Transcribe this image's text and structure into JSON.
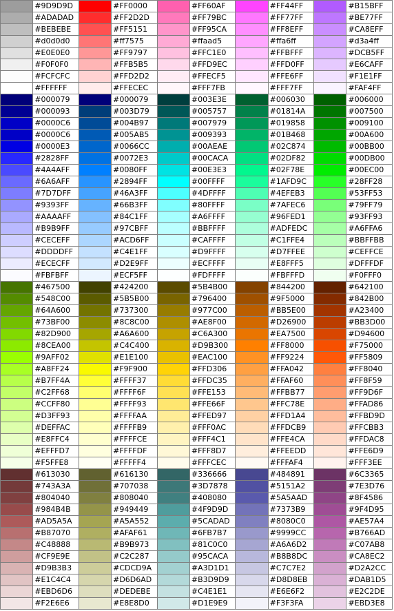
{
  "palette_rows": [
    [
      "#9D9D9D",
      "#FF0000",
      "#FF60AF",
      "#FF44FF",
      "#B15BFF"
    ],
    [
      "#ADADAD",
      "#FF2D2D",
      "#FF79BC",
      "#FF77FF",
      "#BE77FF"
    ],
    [
      "#BEBEBE",
      "#FF5151",
      "#FF95CA",
      "#FF8EFF",
      "#CA8EFF"
    ],
    [
      "#d0d0d0",
      "#ff7575",
      "#ffaad5",
      "#ffa6ff",
      "#d3a4ff"
    ],
    [
      "#E0E0E0",
      "#FF9797",
      "#FFC1E0",
      "#FFBFFF",
      "#DCB5FF"
    ],
    [
      "#F0F0F0",
      "#FFB5B5",
      "#FFD9EC",
      "#FFD0FF",
      "#E6CAFF"
    ],
    [
      "#FCFCFC",
      "#FFD2D2",
      "#FFECF5",
      "#FFE6FF",
      "#F1E1FF"
    ],
    [
      "#FFFFFF",
      "#FFECEC",
      "#FFF7FB",
      "#FFF7FF",
      "#FAF4FF"
    ],
    [
      "#000079",
      "#000079",
      "#003E3E",
      "#006030",
      "#006000"
    ],
    [
      "#000093",
      "#003D79",
      "#005757",
      "#01814A",
      "#007500"
    ],
    [
      "#0000C6",
      "#004B97",
      "#007979",
      "#019858",
      "#009100"
    ],
    [
      "#0000C6",
      "#005AB5",
      "#009393",
      "#01B468",
      "#00A600"
    ],
    [
      "#0000E3",
      "#0066CC",
      "#00AEAE",
      "#02C874",
      "#00BB00"
    ],
    [
      "#2828FF",
      "#0072E3",
      "#00CACA",
      "#02DF82",
      "#00DB00"
    ],
    [
      "#4A4AFF",
      "#0080FF",
      "#00E3E3",
      "#02F78E",
      "#00EC00"
    ],
    [
      "#6A6AFF",
      "#2894FF",
      "#00FFFF",
      "#1AFD9C",
      "#28FF28"
    ],
    [
      "#7D7DFF",
      "#46A3FF",
      "#4DFFFF",
      "#4EFEB3",
      "#53FF53"
    ],
    [
      "#9393FF",
      "#66B3FF",
      "#80FFFF",
      "#7AFEC6",
      "#79FF79"
    ],
    [
      "#AAAAFF",
      "#84C1FF",
      "#A6FFFF",
      "#96FED1",
      "#93FF93"
    ],
    [
      "#B9B9FF",
      "#97CBFF",
      "#BBFFFF",
      "#ADFEDC",
      "#A6FFA6"
    ],
    [
      "#CECEFF",
      "#ACD6FF",
      "#CAFFFF",
      "#C1FFE4",
      "#BBFFBB"
    ],
    [
      "#DDDDFF",
      "#C4E1FF",
      "#D9FFFF",
      "#D7FFEE",
      "#CEFFCE"
    ],
    [
      "#ECECFF",
      "#D2E9FF",
      "#ECFFFF",
      "#E8FFF5",
      "#DFFFDF"
    ],
    [
      "#FBFBFF",
      "#ECF5FF",
      "#FDFFFF",
      "#FBFFFD",
      "#F0FFF0"
    ],
    [
      "#467500",
      "#424200",
      "#5B4B00",
      "#844200",
      "#642100"
    ],
    [
      "#548C00",
      "#5B5B00",
      "#796400",
      "#9F5000",
      "#842B00"
    ],
    [
      "#64A600",
      "#737300",
      "#977C00",
      "#BB5E00",
      "#A23400"
    ],
    [
      "#73BF00",
      "#8C8C00",
      "#AE8F00",
      "#D26900",
      "#BB3D00"
    ],
    [
      "#82D900",
      "#A6A600",
      "#C6A300",
      "#EA7500",
      "#D94600"
    ],
    [
      "#8CEA00",
      "#C4C400",
      "#D9B300",
      "#FF8000",
      "#F75000"
    ],
    [
      "#9AFF02",
      "#E1E100",
      "#EAC100",
      "#FF9224",
      "#FF5809"
    ],
    [
      "#A8FF24",
      "#F9F900",
      "#FFD306",
      "#FFA042",
      "#FF8040"
    ],
    [
      "#B7FF4A",
      "#FFFF37",
      "#FFDC35",
      "#FFAF60",
      "#FF8F59"
    ],
    [
      "#C2FF68",
      "#FFFF6F",
      "#FFE153",
      "#FFBB77",
      "#FF9D6F"
    ],
    [
      "#CCFF80",
      "#FFFF93",
      "#FFE66F",
      "#FFC78E",
      "#FFAD86"
    ],
    [
      "#D3FF93",
      "#FFFFAA",
      "#FFED97",
      "#FFD1A4",
      "#FFBD9D"
    ],
    [
      "#DEFFAC",
      "#FFFFB9",
      "#FFF0AC",
      "#FFDCB9",
      "#FFCBB3"
    ],
    [
      "#E8FFC4",
      "#FFFFCE",
      "#FFF4C1",
      "#FFE4CA",
      "#FFDAC8"
    ],
    [
      "#EFFFD7",
      "#FFFFDF",
      "#FFF8D7",
      "#FFEEDD",
      "#FFE6D9"
    ],
    [
      "#F5FFE8",
      "#FFFFF4",
      "#FFFCEC",
      "#FFFAF4",
      "#FFF3EE"
    ],
    [
      "#613030",
      "#616130",
      "#336666",
      "#484891",
      "#6C3365"
    ],
    [
      "#743A3A",
      "#707038",
      "#3D7878",
      "#5151A2",
      "#7E3D76"
    ],
    [
      "#804040",
      "#808040",
      "#408080",
      "#5A5AAD",
      "#8F4586"
    ],
    [
      "#984B4B",
      "#949449",
      "#4F9D9D",
      "#7373B9",
      "#9F4D95"
    ],
    [
      "#AD5A5A",
      "#A5A552",
      "#5CADAD",
      "#8080C0",
      "#AE57A4"
    ],
    [
      "#B87070",
      "#AFAF61",
      "#6FB7B7",
      "#9999CC",
      "#B766AD"
    ],
    [
      "#C48888",
      "#B9B973",
      "#81C0C0",
      "#A6A6D2",
      "#C07AB8"
    ],
    [
      "#CF9E9E",
      "#C2C287",
      "#95CACA",
      "#B8B8DC",
      "#CA8EC2"
    ],
    [
      "#D9B3B3",
      "#CDCD9A",
      "#A3D1D1",
      "#C7C7E2",
      "#D2A2CC"
    ],
    [
      "#E1C4C4",
      "#D6D6AD",
      "#B3D9D9",
      "#D8D8EB",
      "#DAB1D5"
    ],
    [
      "#EBD6D6",
      "#DEDEBE",
      "#C4E1E1",
      "#E6E6F2",
      "#E2C2DE"
    ],
    [
      "#F2E6E6",
      "#E8E8D0",
      "#D1E9E9",
      "#F3F3FA",
      "#EBD3E8"
    ]
  ]
}
